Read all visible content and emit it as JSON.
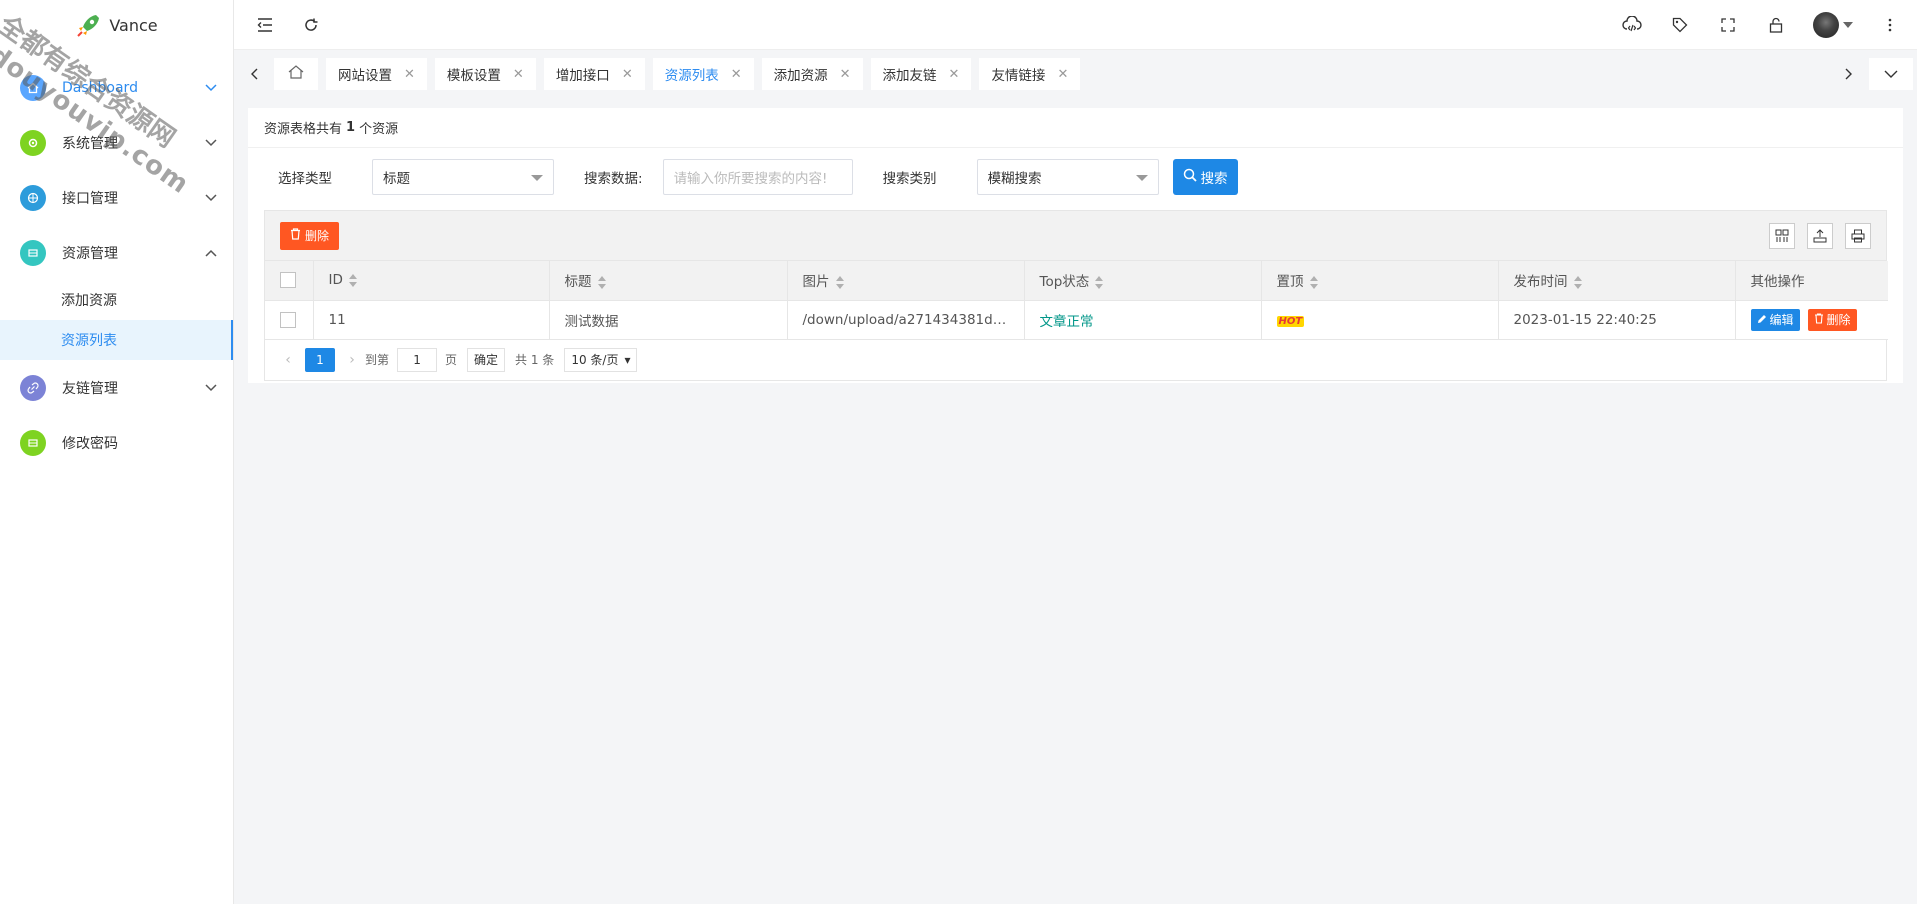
{
  "app": {
    "name": "Vance"
  },
  "watermark": {
    "line1": "全都有综合资源网",
    "line2": "douyouvip.com"
  },
  "sidebar": {
    "items": [
      {
        "label": "Dashboard",
        "color": "#5aa6ff"
      },
      {
        "label": "系统管理",
        "color": "#7ed321"
      },
      {
        "label": "接口管理",
        "color": "#2d9cdb"
      },
      {
        "label": "资源管理",
        "color": "#34c6c0"
      },
      {
        "label": "友链管理",
        "color": "#7c83d6"
      },
      {
        "label": "修改密码",
        "color": "#7ed321"
      }
    ],
    "subitems": [
      {
        "label": "添加资源"
      },
      {
        "label": "资源列表"
      }
    ]
  },
  "tabs": [
    {
      "label": "网站设置"
    },
    {
      "label": "模板设置"
    },
    {
      "label": "增加接口"
    },
    {
      "label": "资源列表"
    },
    {
      "label": "添加资源"
    },
    {
      "label": "添加友链"
    },
    {
      "label": "友情链接"
    }
  ],
  "summary": {
    "prefix": "资源表格共有",
    "count": "1",
    "suffix": "个资源"
  },
  "search": {
    "type_label": "选择类型",
    "type_value": "标题",
    "data_label": "搜索数据:",
    "data_placeholder": "请输入你所要搜索的内容!",
    "category_label": "搜索类别",
    "category_value": "模糊搜索",
    "button": "搜索"
  },
  "toolbar": {
    "delete_label": "删除"
  },
  "table": {
    "columns": [
      "ID",
      "标题",
      "图片",
      "Top状态",
      "置顶",
      "发布时间",
      "其他操作"
    ],
    "rows": [
      {
        "id": "11",
        "title": "测试数据",
        "image": "/down/upload/a271434381df6...",
        "status": "文章正常",
        "top": "HOT",
        "time": "2023-01-15 22:40:25",
        "edit": "编辑",
        "remove": "删除"
      }
    ]
  },
  "pager": {
    "current": "1",
    "goto_label": "到第",
    "goto_value": "1",
    "page_suffix": "页",
    "confirm": "确定",
    "total": "共 1 条",
    "size": "10 条/页"
  }
}
